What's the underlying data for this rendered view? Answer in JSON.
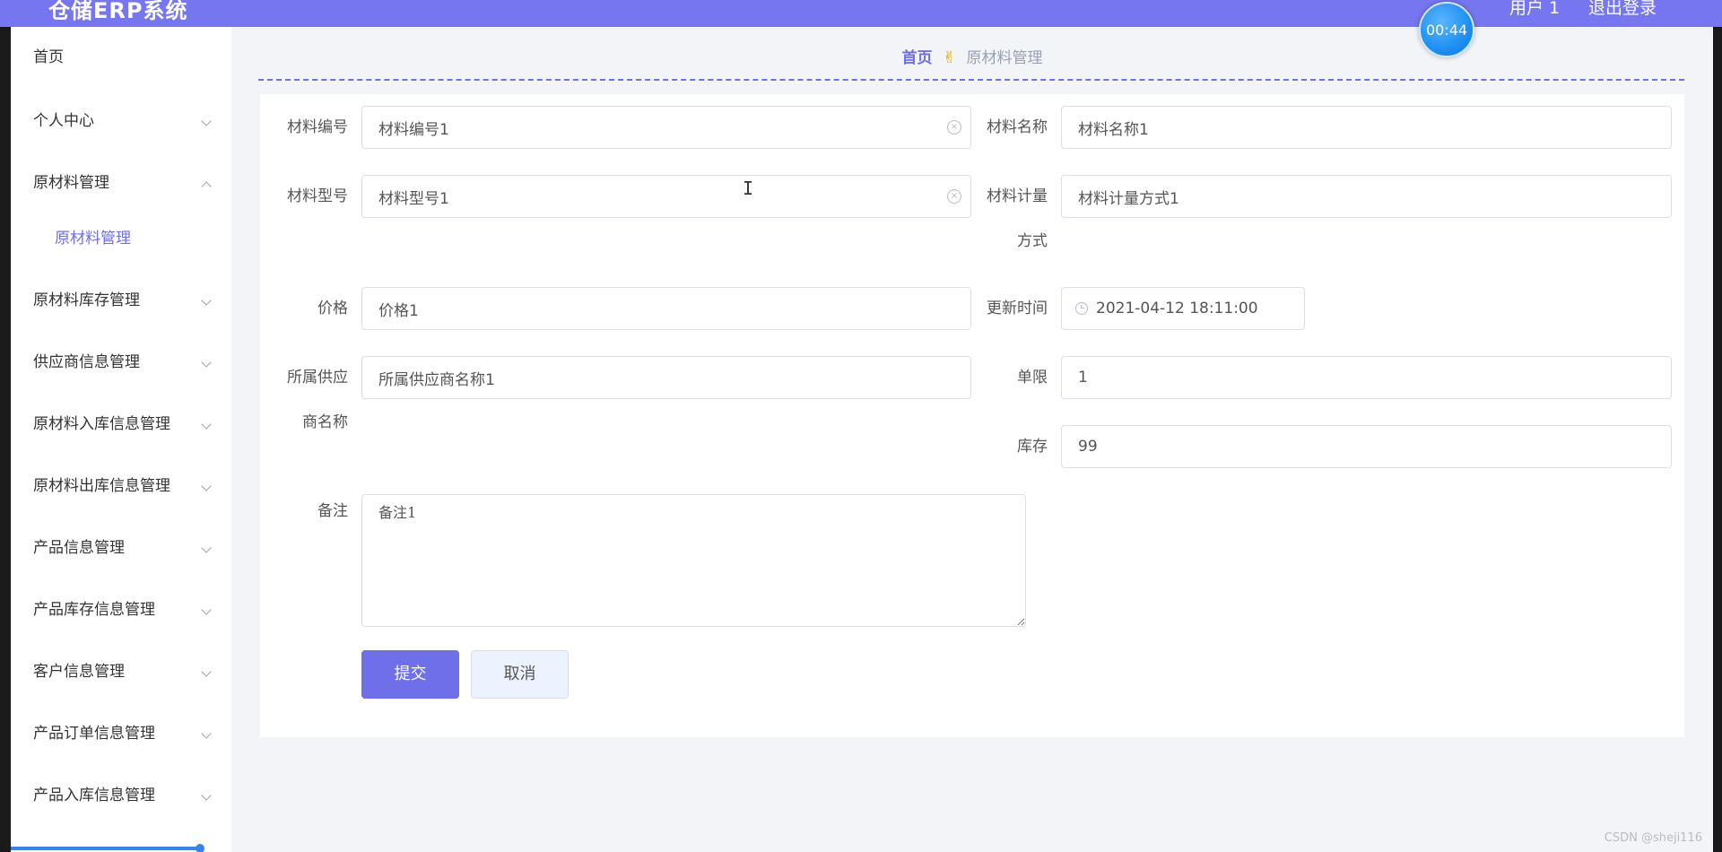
{
  "header": {
    "app_title": "仓储ERP系统",
    "user_label": "用户 1",
    "logout_label": "退出登录",
    "timer": "00:44"
  },
  "sidebar": {
    "items": [
      {
        "label": "首页"
      },
      {
        "label": "个人中心"
      },
      {
        "label": "原材料管理",
        "expanded": true,
        "sub": [
          {
            "label": "原材料管理",
            "active": true
          }
        ]
      },
      {
        "label": "原材料库存管理"
      },
      {
        "label": "供应商信息管理"
      },
      {
        "label": "原材料入库信息管理"
      },
      {
        "label": "原材料出库信息管理"
      },
      {
        "label": "产品信息管理"
      },
      {
        "label": "产品库存信息管理"
      },
      {
        "label": "客户信息管理"
      },
      {
        "label": "产品订单信息管理"
      },
      {
        "label": "产品入库信息管理"
      }
    ]
  },
  "breadcrumb": {
    "home": "首页",
    "current": "原材料管理"
  },
  "form": {
    "material_code": {
      "label": "材料编号",
      "value": "材料编号1"
    },
    "material_name": {
      "label": "材料名称",
      "value": "材料名称1"
    },
    "material_model": {
      "label": "材料型号",
      "value": "材料型号1"
    },
    "measure_method": {
      "label_line1": "材料计量",
      "label_line2": "方式",
      "value": "材料计量方式1"
    },
    "price": {
      "label": "价格",
      "value": "价格1"
    },
    "update_time": {
      "label": "更新时间",
      "value": "2021-04-12 18:11:00"
    },
    "supplier_name": {
      "label_line1": "所属供应",
      "label_line2": "商名称",
      "value": "所属供应商名称1"
    },
    "limit": {
      "label": "单限",
      "value": "1"
    },
    "stock": {
      "label": "库存",
      "value": "99"
    },
    "remark": {
      "label": "备注",
      "value": "备注1"
    },
    "submit_label": "提交",
    "cancel_label": "取消"
  },
  "watermark": "CSDN @sheji116",
  "colors": {
    "header": "#7676f0",
    "accent": "#6f6fea",
    "timer": "#1e8ff2"
  }
}
